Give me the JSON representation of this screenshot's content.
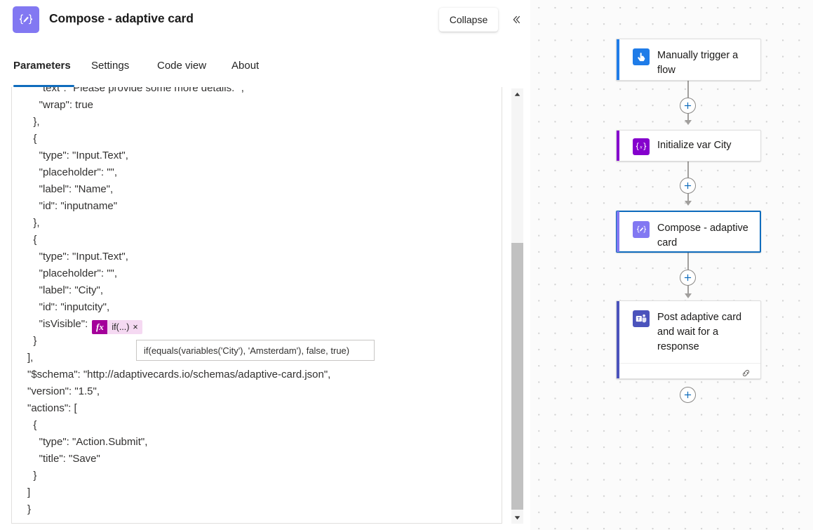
{
  "panel": {
    "title": "Compose - adaptive card",
    "icon": "compose-braces-pencil-icon",
    "collapse_label": "Collapse",
    "collapse_chevron_icon": "chevron-double-left-icon",
    "tabs": [
      {
        "label": "Parameters",
        "active": true
      },
      {
        "label": "Settings",
        "active": false
      },
      {
        "label": "Code view",
        "active": false
      },
      {
        "label": "About",
        "active": false
      }
    ]
  },
  "code": {
    "lines": [
      "    \"text\": \"Please provide some more details. \",",
      "    \"wrap\": true",
      "  },",
      "  {",
      "    \"type\": \"Input.Text\",",
      "    \"placeholder\": \"\",",
      "    \"label\": \"Name\",",
      "    \"id\": \"inputname\"",
      "  },",
      "  {",
      "    \"type\": \"Input.Text\",",
      "    \"placeholder\": \"\",",
      "    \"label\": \"City\",",
      "    \"id\": \"inputcity\",",
      "__FX__",
      "  }",
      "],",
      "\"$schema\": \"http://adaptivecards.io/schemas/adaptive-card.json\",",
      "\"version\": \"1.5\",",
      "\"actions\": [",
      "  {",
      "    \"type\": \"Action.Submit\",",
      "    \"title\": \"Save\"",
      "  }",
      "]",
      "}"
    ],
    "fx_line_prefix": "    \"isVisible\": ",
    "fx_badge": "fx",
    "fx_token_label": "if(...)",
    "fx_token_remove": "×",
    "fx_tooltip": "if(equals(variables('City'), 'Amsterdam'), false, true)",
    "scrollbar": {
      "up_arrow_icon": "triangle-up-icon",
      "down_arrow_icon": "triangle-down-icon"
    }
  },
  "flow": {
    "nodes": [
      {
        "title": "Manually trigger a flow",
        "icon": "manual-trigger-hand-icon",
        "icon_color": "#1f7ce8",
        "accent_color": "#1f7ce8",
        "selected": false,
        "has_footer": false
      },
      {
        "title": "Initialize var City",
        "icon": "variable-braces-x-icon",
        "icon_color": "#8500cd",
        "accent_color": "#8500cd",
        "selected": false,
        "has_footer": false
      },
      {
        "title": "Compose - adaptive card",
        "icon": "compose-braces-pencil-icon",
        "icon_color": "#8278f2",
        "accent_color": "#8278f2",
        "selected": true,
        "has_footer": false
      },
      {
        "title": "Post adaptive card and wait for a response",
        "icon": "microsoft-teams-icon",
        "icon_color": "#4b53bc",
        "accent_color": "#4b53bc",
        "selected": false,
        "has_footer": true,
        "footer_icon": "link-chain-icon"
      }
    ],
    "add_step_icon": "plus-icon",
    "add_step_count": 4
  },
  "colors": {
    "accent_blue": "#0f6cbd",
    "formula_magenta": "#a4009a",
    "formula_pink": "#f5d9f2",
    "connector_gray": "#a19f9d"
  }
}
